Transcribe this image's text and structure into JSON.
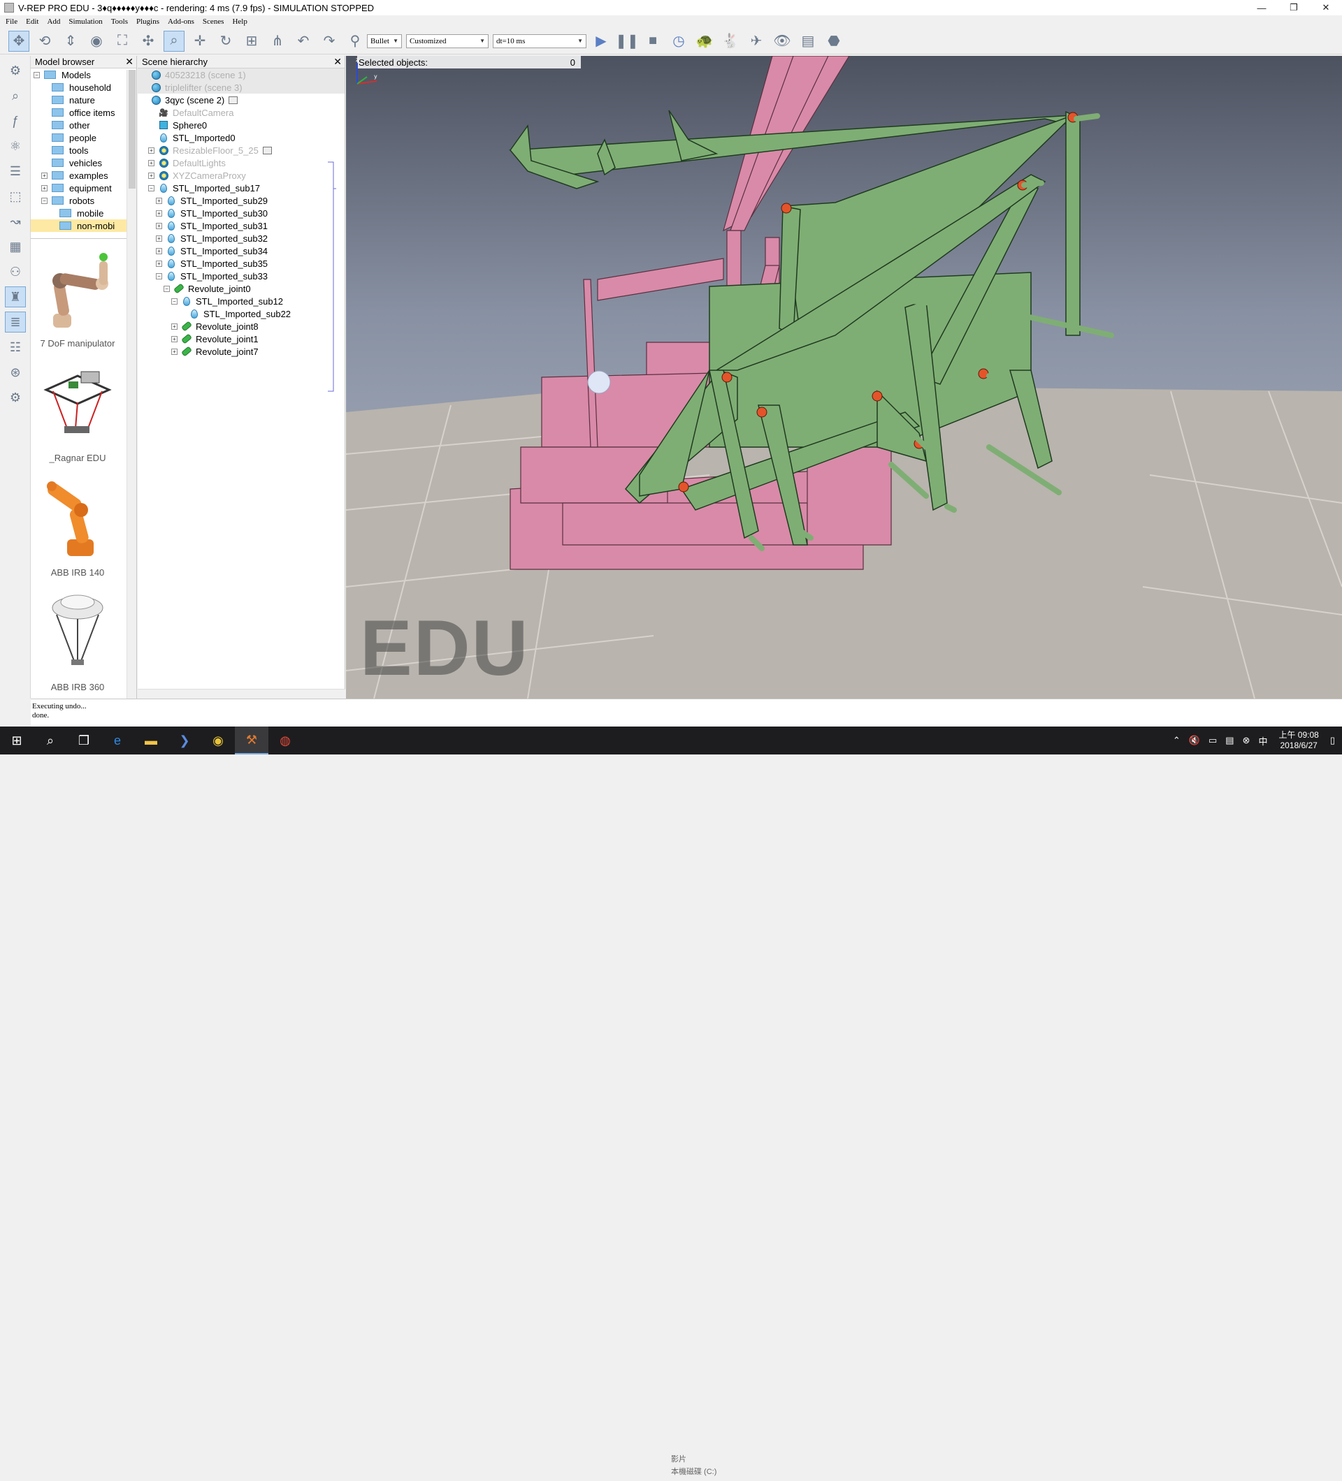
{
  "window": {
    "title": "V-REP PRO EDU - 3♦q♦♦♦♦♦y♦♦♦c - rendering: 4 ms (7.9 fps) - SIMULATION STOPPED",
    "controls": [
      "minimize-icon",
      "restore-icon",
      "close-icon"
    ]
  },
  "menu": [
    "File",
    "Edit",
    "Add",
    "Simulation",
    "Tools",
    "Plugins",
    "Add-ons",
    "Scenes",
    "Help"
  ],
  "toolbar": {
    "engine": "Bullet",
    "preset": "Customized",
    "timestep": "dt=10 ms"
  },
  "model_browser": {
    "title": "Model browser",
    "folders": [
      {
        "label": "Models",
        "level": 0,
        "expander": "−"
      },
      {
        "label": "household",
        "level": 1,
        "expander": ""
      },
      {
        "label": "nature",
        "level": 1,
        "expander": ""
      },
      {
        "label": "office items",
        "level": 1,
        "expander": ""
      },
      {
        "label": "other",
        "level": 1,
        "expander": ""
      },
      {
        "label": "people",
        "level": 1,
        "expander": ""
      },
      {
        "label": "tools",
        "level": 1,
        "expander": ""
      },
      {
        "label": "vehicles",
        "level": 1,
        "expander": ""
      },
      {
        "label": "examples",
        "level": 1,
        "expander": "+"
      },
      {
        "label": "equipment",
        "level": 1,
        "expander": "+"
      },
      {
        "label": "robots",
        "level": 1,
        "expander": "−"
      },
      {
        "label": "mobile",
        "level": 2,
        "expander": ""
      },
      {
        "label": "non-mobi",
        "level": 2,
        "expander": ""
      }
    ],
    "thumbnails": [
      "7 DoF manipulator",
      "_Ragnar EDU",
      "ABB IRB 140",
      "ABB IRB 360"
    ]
  },
  "scene_hierarchy": {
    "title": "Scene hierarchy",
    "rows": [
      {
        "label": "40523218 (scene 1)",
        "indent": 0,
        "icon": "globe",
        "exp": "",
        "dim": true,
        "sel": true,
        "tag": false
      },
      {
        "label": "triplelifter (scene 3)",
        "indent": 0,
        "icon": "globe",
        "exp": "",
        "dim": true,
        "sel": true,
        "tag": false
      },
      {
        "label": "3qyc (scene 2)",
        "indent": 0,
        "icon": "globe",
        "exp": "",
        "dim": false,
        "sel": false,
        "tag": true
      },
      {
        "label": "DefaultCamera",
        "indent": 1,
        "icon": "camera",
        "exp": "",
        "dim": true,
        "sel": false,
        "tag": false
      },
      {
        "label": "Sphere0",
        "indent": 1,
        "icon": "cube",
        "exp": "",
        "dim": false,
        "sel": false,
        "tag": false
      },
      {
        "label": "STL_Imported0",
        "indent": 1,
        "icon": "drop",
        "exp": "",
        "dim": false,
        "sel": false,
        "tag": false
      },
      {
        "label": "ResizableFloor_5_25",
        "indent": 1,
        "icon": "sun",
        "exp": "+",
        "dim": true,
        "sel": false,
        "tag": true
      },
      {
        "label": "DefaultLights",
        "indent": 1,
        "icon": "sun",
        "exp": "+",
        "dim": true,
        "sel": false,
        "tag": false
      },
      {
        "label": "XYZCameraProxy",
        "indent": 1,
        "icon": "sun",
        "exp": "+",
        "dim": true,
        "sel": false,
        "tag": false
      },
      {
        "label": "STL_Imported_sub17",
        "indent": 1,
        "icon": "drop",
        "exp": "−",
        "dim": false,
        "sel": false,
        "tag": false
      },
      {
        "label": "STL_Imported_sub29",
        "indent": 2,
        "icon": "drop",
        "exp": "+",
        "dim": false,
        "sel": false,
        "tag": false
      },
      {
        "label": "STL_Imported_sub30",
        "indent": 2,
        "icon": "drop",
        "exp": "+",
        "dim": false,
        "sel": false,
        "tag": false
      },
      {
        "label": "STL_Imported_sub31",
        "indent": 2,
        "icon": "drop",
        "exp": "+",
        "dim": false,
        "sel": false,
        "tag": false
      },
      {
        "label": "STL_Imported_sub32",
        "indent": 2,
        "icon": "drop",
        "exp": "+",
        "dim": false,
        "sel": false,
        "tag": false
      },
      {
        "label": "STL_Imported_sub34",
        "indent": 2,
        "icon": "drop",
        "exp": "+",
        "dim": false,
        "sel": false,
        "tag": false
      },
      {
        "label": "STL_Imported_sub35",
        "indent": 2,
        "icon": "drop",
        "exp": "+",
        "dim": false,
        "sel": false,
        "tag": false
      },
      {
        "label": "STL_Imported_sub33",
        "indent": 2,
        "icon": "drop",
        "exp": "−",
        "dim": false,
        "sel": false,
        "tag": false
      },
      {
        "label": "Revolute_joint0",
        "indent": 3,
        "icon": "joint",
        "exp": "−",
        "dim": false,
        "sel": false,
        "tag": false
      },
      {
        "label": "STL_Imported_sub12",
        "indent": 4,
        "icon": "drop",
        "exp": "−",
        "dim": false,
        "sel": false,
        "tag": false
      },
      {
        "label": "STL_Imported_sub22",
        "indent": 5,
        "icon": "drop",
        "exp": "",
        "dim": false,
        "sel": false,
        "tag": false
      },
      {
        "label": "Revolute_joint8",
        "indent": 4,
        "icon": "joint",
        "exp": "+",
        "dim": false,
        "sel": false,
        "tag": false
      },
      {
        "label": "Revolute_joint1",
        "indent": 4,
        "icon": "joint",
        "exp": "+",
        "dim": false,
        "sel": false,
        "tag": false
      },
      {
        "label": "Revolute_joint7",
        "indent": 4,
        "icon": "joint",
        "exp": "+",
        "dim": false,
        "sel": false,
        "tag": false
      }
    ]
  },
  "viewport": {
    "selected_label": "Selected objects:",
    "selected_count": "0",
    "watermark": "EDU"
  },
  "console": {
    "lines": [
      "Executing undo...",
      "done."
    ]
  },
  "taskbar": {
    "apps": [
      "start-icon",
      "search-icon",
      "task-view-icon",
      "edge-icon",
      "explorer-icon",
      "powershell-icon",
      "chrome-icon",
      "vrep-icon",
      "app-icon"
    ],
    "ghost_lines": [
      "影片",
      "本機磁碟 (C:)"
    ],
    "clock_time": "上午 09:08",
    "clock_date": "2018/6/27"
  },
  "colors": {
    "mechanism_green": "#7fae74",
    "frame_pink": "#d98aa8",
    "joint_orange": "#e4542a",
    "selection_blue": "#c9dff5"
  }
}
